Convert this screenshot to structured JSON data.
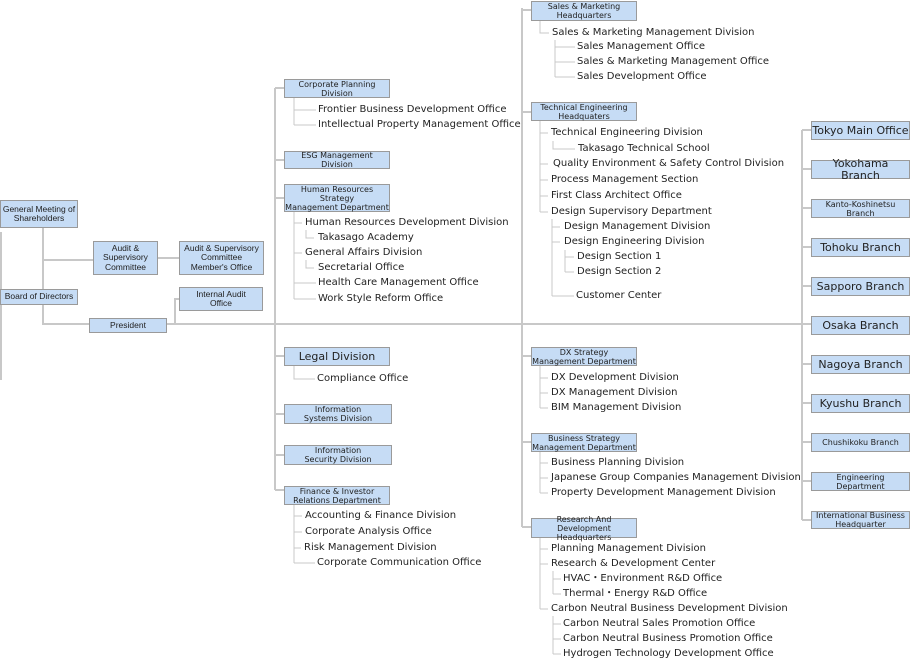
{
  "top": {
    "general_meeting": "General Meeting of\nShareholders",
    "audit_committee": "Audit &\nSupervisory\nCommittee",
    "audit_office": "Audit & Supervisory\nCommittee\nMember's Office",
    "board": "Board of Directors",
    "internal_audit": "Internal Audit\nOffice",
    "president": "President"
  },
  "corporate": {
    "corporate_planning": {
      "label": "Corporate Planning Division",
      "children": [
        "Frontier  Business Development Office",
        "Intellectual Property Management Office"
      ]
    },
    "esg": {
      "label": "ESG Management Division"
    },
    "hr": {
      "label": "Human Resources Strategy\nManagement Department",
      "children": [
        "Human Resources Development Division",
        "Takasago Academy",
        "General Affairs Division",
        "Secretarial Office",
        "Health Care Management Office",
        "Work Style Reform Office"
      ]
    },
    "legal": {
      "label": "Legal Division",
      "children": [
        "Compliance Office"
      ]
    },
    "info_systems": {
      "label": "Information\nSystems Division"
    },
    "info_security": {
      "label": "Information\nSecurity Division"
    },
    "finance": {
      "label": "Finance & Investor\nRelations Department",
      "children": [
        "Accounting & Finance Division",
        "Corporate Analysis Office",
        "Risk Management Division",
        "Corporate Communication Office"
      ]
    }
  },
  "operations": {
    "sales": {
      "label": "Sales & Marketing\nHeadquarters",
      "children": [
        "Sales & Marketing Management Division",
        "Sales Management Office",
        "Sales & Marketing Management Office",
        "Sales Development Office"
      ]
    },
    "tech": {
      "label": "Technical Engineering\nHeadquaters",
      "children": [
        "Technical Engineering Division",
        "Takasago Technical School",
        "Quality Environment & Safety Control Division",
        "Process Management Section",
        "First Class Architect Office",
        "Design Supervisory Department",
        "Design Management Division",
        "Design Engineering Division",
        "Design Section 1",
        "Design Section 2",
        "Customer Center"
      ]
    },
    "dx": {
      "label": "DX  Strategy\nManagement Department",
      "children": [
        "DX  Development Division",
        "DX  Management Division",
        "BIM Management Division"
      ]
    },
    "business": {
      "label": "Business  Strategy\nManagement Department",
      "children": [
        "Business Planning Division",
        "Japanese Group Companies Management Division",
        "Property Development Management Division"
      ]
    },
    "rnd": {
      "label": "Research And\nDevelopment Headquarters",
      "children": [
        "Planning Management Division",
        "Research & Development Center",
        "HVAC・Environment R&D Office",
        "Thermal・Energy R&D Office",
        "Carbon Neutral Business Development Division",
        "Carbon Neutral Sales Promotion Office",
        "Carbon Neutral Business Promotion Office",
        "Hydrogen Technology Development Office"
      ]
    }
  },
  "branches": [
    "Tokyo Main Office",
    "Yokohama Branch",
    "Kanto-Koshinetsu\nBranch",
    "Tohoku Branch",
    "Sapporo Branch",
    "Osaka Branch",
    "Nagoya Branch",
    "Kyushu Branch",
    "Chushikoku Branch",
    "Engineering\nDepartment",
    "International Business\nHeadquarter"
  ],
  "colors": {
    "box_fill": "#c6dcf5",
    "box_border": "#9a9a9a",
    "connector": "#c8c8c8"
  }
}
